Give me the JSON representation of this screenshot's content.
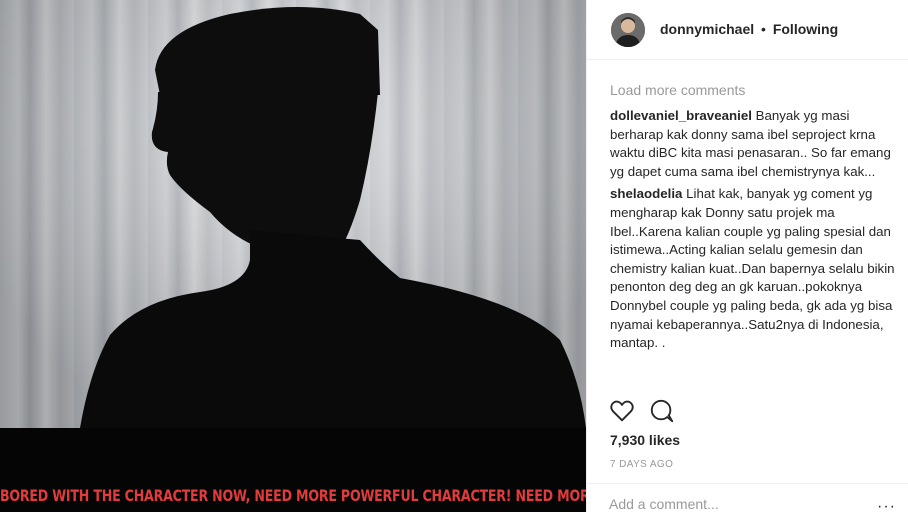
{
  "post": {
    "caption_overlay": "BORED WITH THE CHARACTER NOW, NEED MORE POWERFUL CHARACTER! NEED MORE CHALLENGE!",
    "accent_red": "#e23b3b"
  },
  "header": {
    "username": "donnymichael",
    "separator": "•",
    "follow_status": "Following",
    "avatar_icon": "profile-avatar"
  },
  "comments": {
    "load_more": "Load more comments",
    "items": [
      {
        "user": "dollevaniel_braveaniel",
        "text": "Banyak yg masi berharap kak donny sama ibel seproject krna waktu diBC kita masi penasaran.. So far emang yg dapet cuma sama ibel chemistrynya kak..."
      },
      {
        "user": "shelaodelia",
        "text": "Lihat kak, banyak yg coment yg mengharap kak Donny satu projek ma Ibel..Karena kalian couple yg paling spesial dan istimewa..Acting kalian selalu gemesin dan chemistry kalian kuat..Dan bapernya selalu bikin penonton deg deg an gk karuan..pokoknya Donnybel couple yg paling beda, gk ada yg bisa nyamai kebaperannya..Satu2nya di Indonesia, mantap. ."
      }
    ]
  },
  "actions": {
    "like_icon": "heart-icon",
    "comment_icon": "comment-bubble-icon"
  },
  "likes": "7,930 likes",
  "time_ago": "7 DAYS AGO",
  "add_comment": {
    "placeholder": "Add a comment...",
    "value": ""
  },
  "more_options": "···"
}
